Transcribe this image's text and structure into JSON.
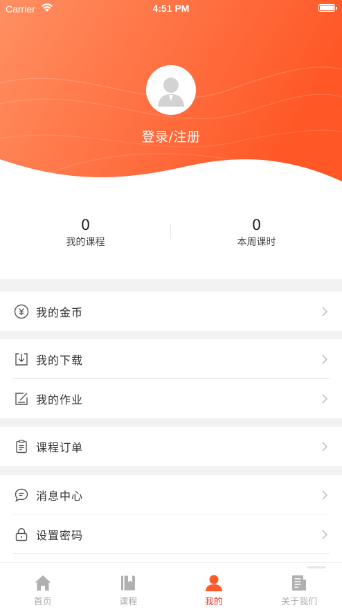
{
  "status_bar": {
    "carrier": "Carrier",
    "time": "4:51 PM"
  },
  "header": {
    "login_text": "登录/注册",
    "gradient_start": "#ff8a5c",
    "gradient_end": "#ff5a2a"
  },
  "stats": [
    {
      "value": "0",
      "label": "我的课程"
    },
    {
      "value": "0",
      "label": "本周课时"
    }
  ],
  "menu_groups": [
    [
      {
        "icon": "coin-icon",
        "label": "我的金币"
      }
    ],
    [
      {
        "icon": "download-icon",
        "label": "我的下载"
      },
      {
        "icon": "homework-icon",
        "label": "我的作业"
      }
    ],
    [
      {
        "icon": "order-icon",
        "label": "课程订单"
      }
    ],
    [
      {
        "icon": "message-icon",
        "label": "消息中心"
      },
      {
        "icon": "lock-icon",
        "label": "设置密码"
      }
    ]
  ],
  "tabbar": {
    "active_color": "#e0311f",
    "inactive_color": "#aaaaaa",
    "tabs": [
      {
        "icon": "home-icon",
        "label": "首页",
        "active": false
      },
      {
        "icon": "book-icon",
        "label": "课程",
        "active": false
      },
      {
        "icon": "user-icon",
        "label": "我的",
        "active": true
      },
      {
        "icon": "document-icon",
        "label": "关于我们",
        "active": false
      }
    ]
  }
}
